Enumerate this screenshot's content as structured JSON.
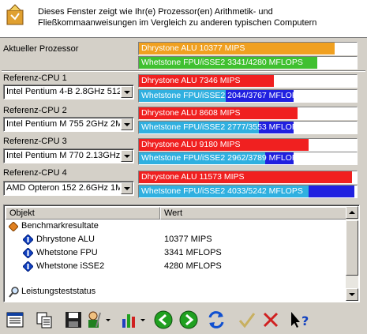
{
  "header": {
    "text": "Dieses Fenster zeigt wie Ihr(e) Prozessor(en) Arithmetik- und Fließkommaanweisungen im Vergleich zu anderen typischen Computern"
  },
  "current": {
    "label": "Aktueller Prozessor",
    "alu": "Dhrystone ALU 10377 MIPS",
    "fpu": "Whetstone FPU/iSSE2 3341/4280 MFLOPS"
  },
  "refs": [
    {
      "label": "Referenz-CPU 1",
      "cpu": "Intel Pentium 4-B 2.8GHz 512L",
      "alu": "Dhrystone ALU 7346 MIPS",
      "fpu": "Whetstone FPU/iSSE2 2044/3767 MFLOPS"
    },
    {
      "label": "Referenz-CPU 2",
      "cpu": "Intel Pentium M 755 2GHz 2ML",
      "alu": "Dhrystone ALU 8608 MIPS",
      "fpu": "Whetstone FPU/iSSE2 2777/3553 MFLOPS"
    },
    {
      "label": "Referenz-CPU 3",
      "cpu": "Intel Pentium M 770 2.13GHz 2",
      "alu": "Dhrystone ALU 9180 MIPS",
      "fpu": "Whetstone FPU/iSSE2 2962/3789 MFLOPS"
    },
    {
      "label": "Referenz-CPU 4",
      "cpu": "AMD Opteron 152 2.6GHz 1ML",
      "alu": "Dhrystone ALU 11573 MIPS",
      "fpu": "Whetstone FPU/iSSE2 4033/5242 MFLOPS"
    }
  ],
  "list": {
    "col_object": "Objekt",
    "col_value": "Wert",
    "group1": "Benchmarkresultate",
    "rows": [
      {
        "name": "Dhrystone ALU",
        "value": "10377 MIPS"
      },
      {
        "name": "Whetstone FPU",
        "value": "3341 MFLOPS"
      },
      {
        "name": "Whetstone iSSE2",
        "value": "4280 MFLOPS"
      }
    ],
    "group2": "Leistungsteststatus"
  },
  "levels": {
    "current_alu": 0.9,
    "current_fpu_a": 0.82,
    "ref_alu": [
      0.62,
      0.73,
      0.78,
      0.98
    ],
    "ref_fpu_a": [
      0.4,
      0.55,
      0.58,
      0.78
    ],
    "ref_fpu_b": [
      0.71,
      0.71,
      0.71,
      0.99
    ]
  },
  "colors": {
    "orange": "#f0a020",
    "green": "#40c030",
    "red": "#f02020",
    "cyan": "#30b0e0",
    "blue": "#2020e0"
  },
  "icons": [
    "header-chip-icon",
    "report-icon",
    "copy-icon",
    "save-icon",
    "user-settings-icon",
    "chart-icon",
    "back-icon",
    "forward-icon",
    "refresh-icon",
    "ok-icon",
    "cancel-icon",
    "help-icon"
  ]
}
